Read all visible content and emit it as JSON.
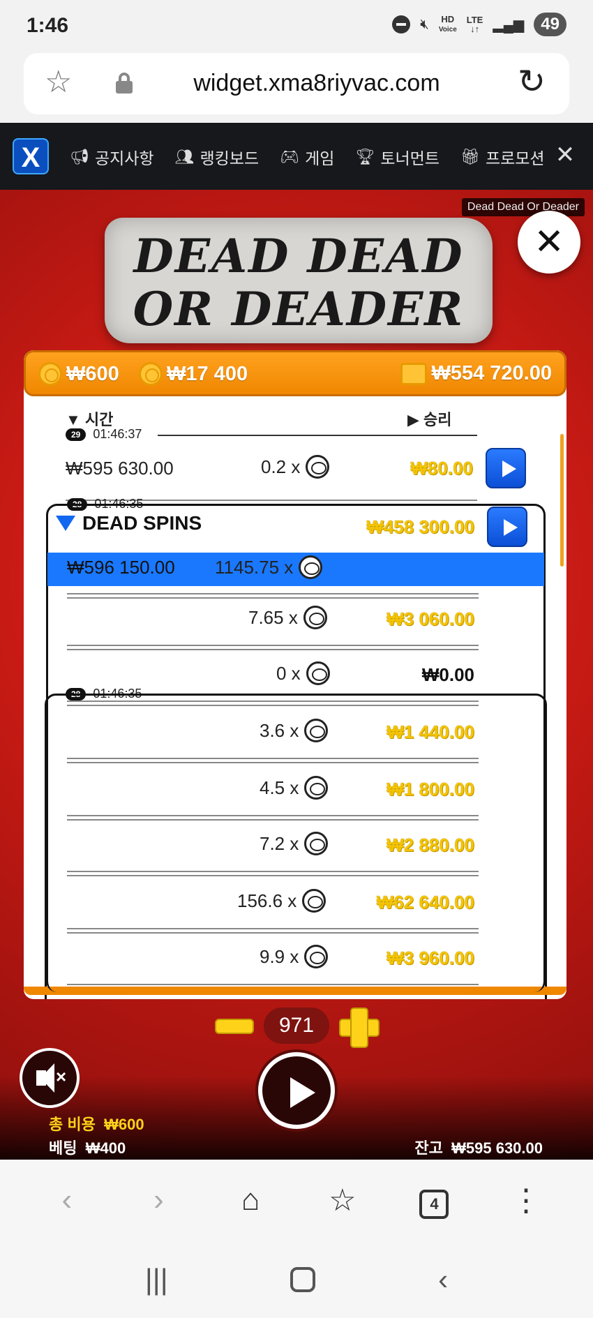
{
  "status": {
    "time": "1:46",
    "hd_label": "HD",
    "voice_label": "Voice",
    "lte_label": "LTE",
    "battery": "49"
  },
  "browser": {
    "url": "widget.xma8riyvac.com",
    "tab_count": "4"
  },
  "site_nav": {
    "items": [
      {
        "label": "공지사항",
        "icon": "megaphone-icon"
      },
      {
        "label": "랭킹보드",
        "icon": "users-icon"
      },
      {
        "label": "게임",
        "icon": "gamepad-icon"
      },
      {
        "label": "토너먼트",
        "icon": "trophy-icon"
      },
      {
        "label": "프로모션",
        "icon": "gift-icon"
      }
    ]
  },
  "game": {
    "title_tag": "Dead Dead Or Deader",
    "logo_line1": "DEAD DEAD",
    "logo_line2": "OR DEADER",
    "header": {
      "cost1": "₩600",
      "cost2": "₩17 400",
      "balance": "₩554 720.00"
    },
    "columns": {
      "time": "시간",
      "win": "승리"
    },
    "rounds": [
      {
        "id": "29",
        "time": "01:46:37",
        "balance": "₩595 630.00",
        "multiplier": "0.2 x",
        "win": "₩80.00"
      },
      {
        "id": "28",
        "time": "01:46:35",
        "feature": "DEAD SPINS",
        "feature_win": "₩458 300.00"
      }
    ],
    "spins": [
      {
        "balance": "₩596 150.00",
        "multiplier": "1145.75 x",
        "win": ""
      },
      {
        "multiplier": "7.65 x",
        "win": "₩3 060.00"
      },
      {
        "multiplier": "0 x",
        "win": "₩0.00"
      },
      {
        "multiplier": "3.6 x",
        "win": "₩1 440.00"
      },
      {
        "multiplier": "4.5 x",
        "win": "₩1 800.00"
      },
      {
        "multiplier": "7.2 x",
        "win": "₩2 880.00"
      },
      {
        "multiplier": "156.6 x",
        "win": "₩62 640.00"
      },
      {
        "multiplier": "9.9 x",
        "win": "₩3 960.00"
      }
    ],
    "bet_count": "971",
    "total_cost_label": "총 비용",
    "total_cost": "₩600",
    "bet_label": "베팅",
    "bet": "₩400",
    "balance_label": "잔고",
    "balance": "₩595 630.00"
  },
  "colors": {
    "accent_orange": "#f08700",
    "win_gold": "#f5c400",
    "highlight_blue": "#1a78ff",
    "game_red": "#c71a14"
  }
}
